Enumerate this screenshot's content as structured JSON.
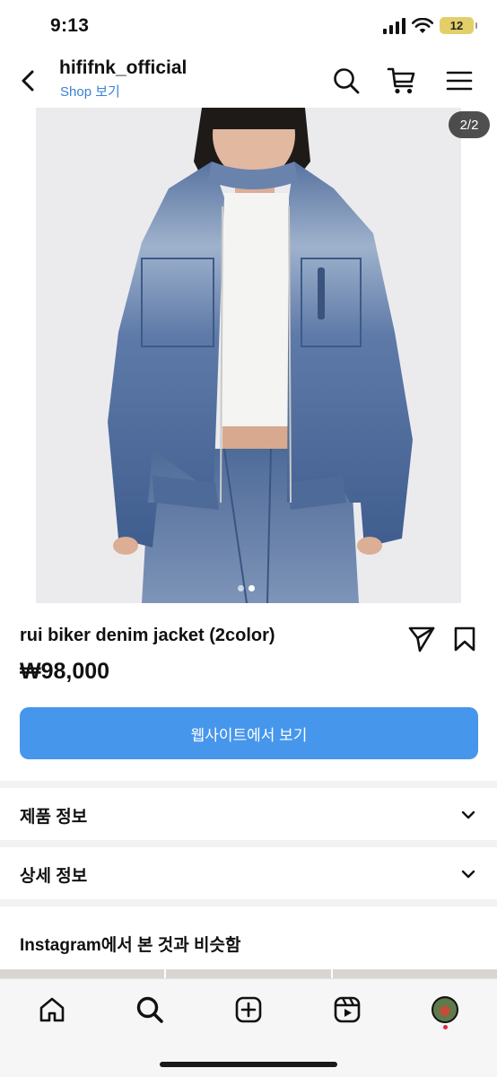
{
  "status_bar": {
    "time": "9:13",
    "battery": "12"
  },
  "header": {
    "account": "hififnk_official",
    "shop_link": "Shop 보기"
  },
  "carousel": {
    "counter": "2/2",
    "current": 2,
    "total": 2
  },
  "product": {
    "title": "rui biker denim jacket (2color)",
    "price": "₩98,000",
    "website_button": "웹사이트에서 보기"
  },
  "sections": [
    {
      "label": "제품 정보"
    },
    {
      "label": "상세 정보"
    }
  ],
  "similar": {
    "title": "Instagram에서 본 것과 비슷함"
  },
  "icons": {
    "header": [
      "back-icon",
      "search-icon",
      "cart-icon",
      "menu-icon"
    ],
    "product": [
      "share-icon",
      "bookmark-icon"
    ],
    "nav": [
      "home-icon",
      "search-icon",
      "create-icon",
      "reels-icon",
      "profile-avatar"
    ]
  },
  "colors": {
    "accent": "#4696ec",
    "link": "#3b82d6",
    "battery": "#e3cf6a"
  }
}
